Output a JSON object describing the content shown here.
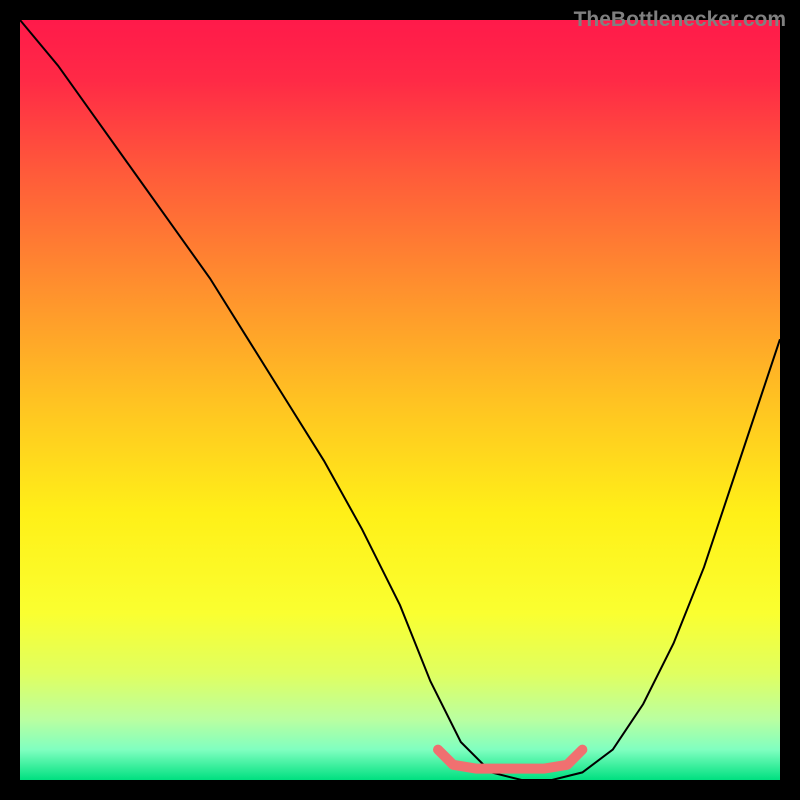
{
  "watermark": "TheBottlenecker.com",
  "chart_data": {
    "type": "line",
    "title": "",
    "xlabel": "",
    "ylabel": "",
    "xlim": [
      0,
      100
    ],
    "ylim": [
      0,
      100
    ],
    "grid": false,
    "legend": false,
    "background_gradient": {
      "stops": [
        {
          "offset": 0.0,
          "color": "#ff1a4a"
        },
        {
          "offset": 0.08,
          "color": "#ff2a46"
        },
        {
          "offset": 0.2,
          "color": "#ff5a3a"
        },
        {
          "offset": 0.35,
          "color": "#ff8f2e"
        },
        {
          "offset": 0.5,
          "color": "#ffc222"
        },
        {
          "offset": 0.65,
          "color": "#fff018"
        },
        {
          "offset": 0.78,
          "color": "#faff30"
        },
        {
          "offset": 0.86,
          "color": "#e0ff60"
        },
        {
          "offset": 0.92,
          "color": "#baffa0"
        },
        {
          "offset": 0.96,
          "color": "#80ffc0"
        },
        {
          "offset": 1.0,
          "color": "#00e080"
        }
      ]
    },
    "series": [
      {
        "name": "bottleneck-curve",
        "color": "#000000",
        "width": 2,
        "x": [
          0,
          5,
          10,
          15,
          20,
          25,
          30,
          35,
          40,
          45,
          50,
          54,
          58,
          62,
          66,
          70,
          74,
          78,
          82,
          86,
          90,
          94,
          98,
          100
        ],
        "y": [
          100,
          94,
          87,
          80,
          73,
          66,
          58,
          50,
          42,
          33,
          23,
          13,
          5,
          1,
          0,
          0,
          1,
          4,
          10,
          18,
          28,
          40,
          52,
          58
        ]
      },
      {
        "name": "optimal-range-marker",
        "color": "#f07070",
        "width": 10,
        "linecap": "round",
        "x": [
          55,
          57,
          60,
          63,
          66,
          69,
          72,
          74
        ],
        "y": [
          4.0,
          2.0,
          1.5,
          1.5,
          1.5,
          1.5,
          2.0,
          4.0
        ]
      }
    ]
  }
}
